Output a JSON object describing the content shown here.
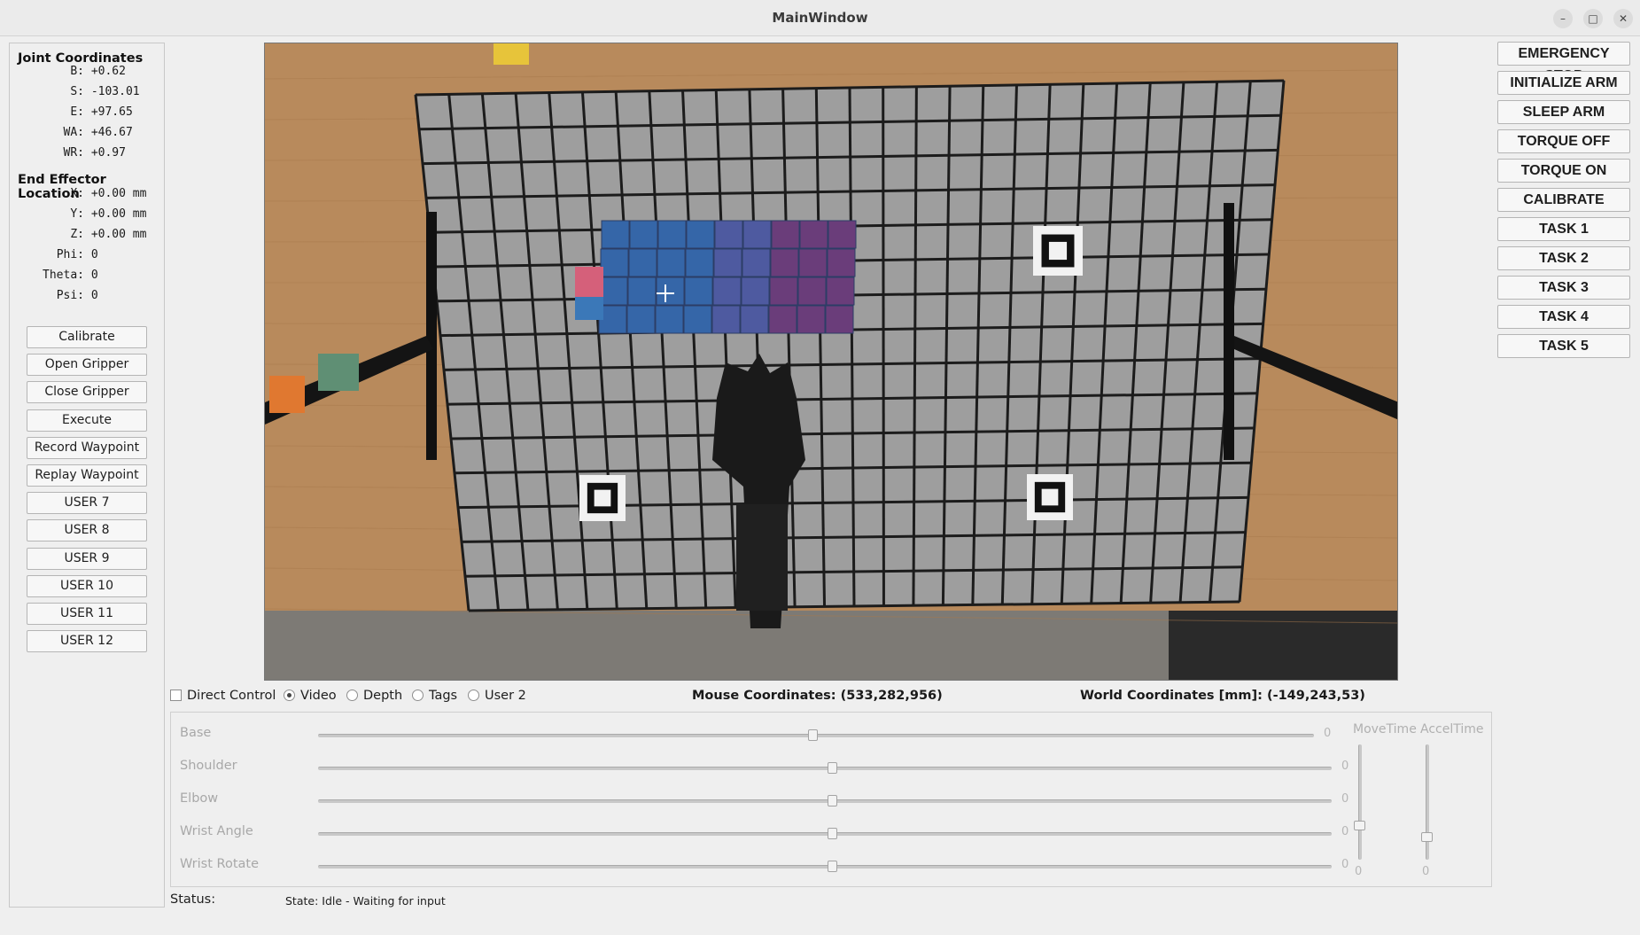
{
  "window": {
    "title": "MainWindow"
  },
  "joint_coordinates": {
    "heading": "Joint Coordinates",
    "rows": [
      {
        "label": "B:",
        "value": "+0.62"
      },
      {
        "label": "S:",
        "value": "-103.01"
      },
      {
        "label": "E:",
        "value": "+97.65"
      },
      {
        "label": "WA:",
        "value": "+46.67"
      },
      {
        "label": "WR:",
        "value": "+0.97"
      }
    ]
  },
  "end_effector": {
    "heading": "End Effector Location",
    "rows": [
      {
        "label": "X:",
        "value": "+0.00 mm"
      },
      {
        "label": "Y:",
        "value": "+0.00 mm"
      },
      {
        "label": "Z:",
        "value": "+0.00 mm"
      },
      {
        "label": "Phi:",
        "value": "0"
      },
      {
        "label": "Theta:",
        "value": "0"
      },
      {
        "label": "Psi:",
        "value": "0"
      }
    ]
  },
  "left_buttons": [
    "Calibrate",
    "Open Gripper",
    "Close Gripper",
    "Execute",
    "Record Waypoint",
    "Replay Waypoint",
    "USER 7",
    "USER 8",
    "USER 9",
    "USER 10",
    "USER 11",
    "USER 12"
  ],
  "right_buttons": [
    "EMERGENCY STOP",
    "INITIALIZE ARM",
    "SLEEP ARM",
    "TORQUE OFF",
    "TORQUE ON",
    "CALIBRATE",
    "TASK 1",
    "TASK 2",
    "TASK 3",
    "TASK 4",
    "TASK 5"
  ],
  "view_options": {
    "direct_control": {
      "label": "Direct Control",
      "checked": false
    },
    "radios": [
      {
        "label": "Video",
        "selected": true
      },
      {
        "label": "Depth",
        "selected": false
      },
      {
        "label": "Tags",
        "selected": false
      },
      {
        "label": "User 2",
        "selected": false
      }
    ]
  },
  "mouse_coordinates": {
    "label": "Mouse Coordinates:",
    "value": "(533,282,956)"
  },
  "world_coordinates": {
    "label": "World Coordinates [mm]:",
    "value": "(-149,243,53)"
  },
  "sliders": [
    {
      "label": "Base",
      "value": "0",
      "position": 0.5
    },
    {
      "label": "Shoulder",
      "value": "0",
      "position": 0.5
    },
    {
      "label": "Elbow",
      "value": "0",
      "position": 0.5
    },
    {
      "label": "Wrist Angle",
      "value": "0",
      "position": 0.5
    },
    {
      "label": "Wrist Rotate",
      "value": "0",
      "position": 0.5
    }
  ],
  "vertical_sliders": [
    {
      "label": "MoveTime",
      "value": "0",
      "position": 0.3
    },
    {
      "label": "AccelTime",
      "value": "0",
      "position": 0.2
    }
  ],
  "status": {
    "label": "Status:",
    "value": "State: Idle - Waiting for input"
  },
  "colors": {
    "wood": "#b88a5c",
    "board": "#9e9e9e",
    "grid_line": "#1c1c1c",
    "block_blue": "#3566a8",
    "block_purple": "#6a3d7a",
    "block_pink": "#d5607a"
  },
  "icons": {
    "minimize": "minimize-icon",
    "maximize": "maximize-icon",
    "close": "close-icon",
    "crosshair": "crosshair-cursor-icon"
  }
}
